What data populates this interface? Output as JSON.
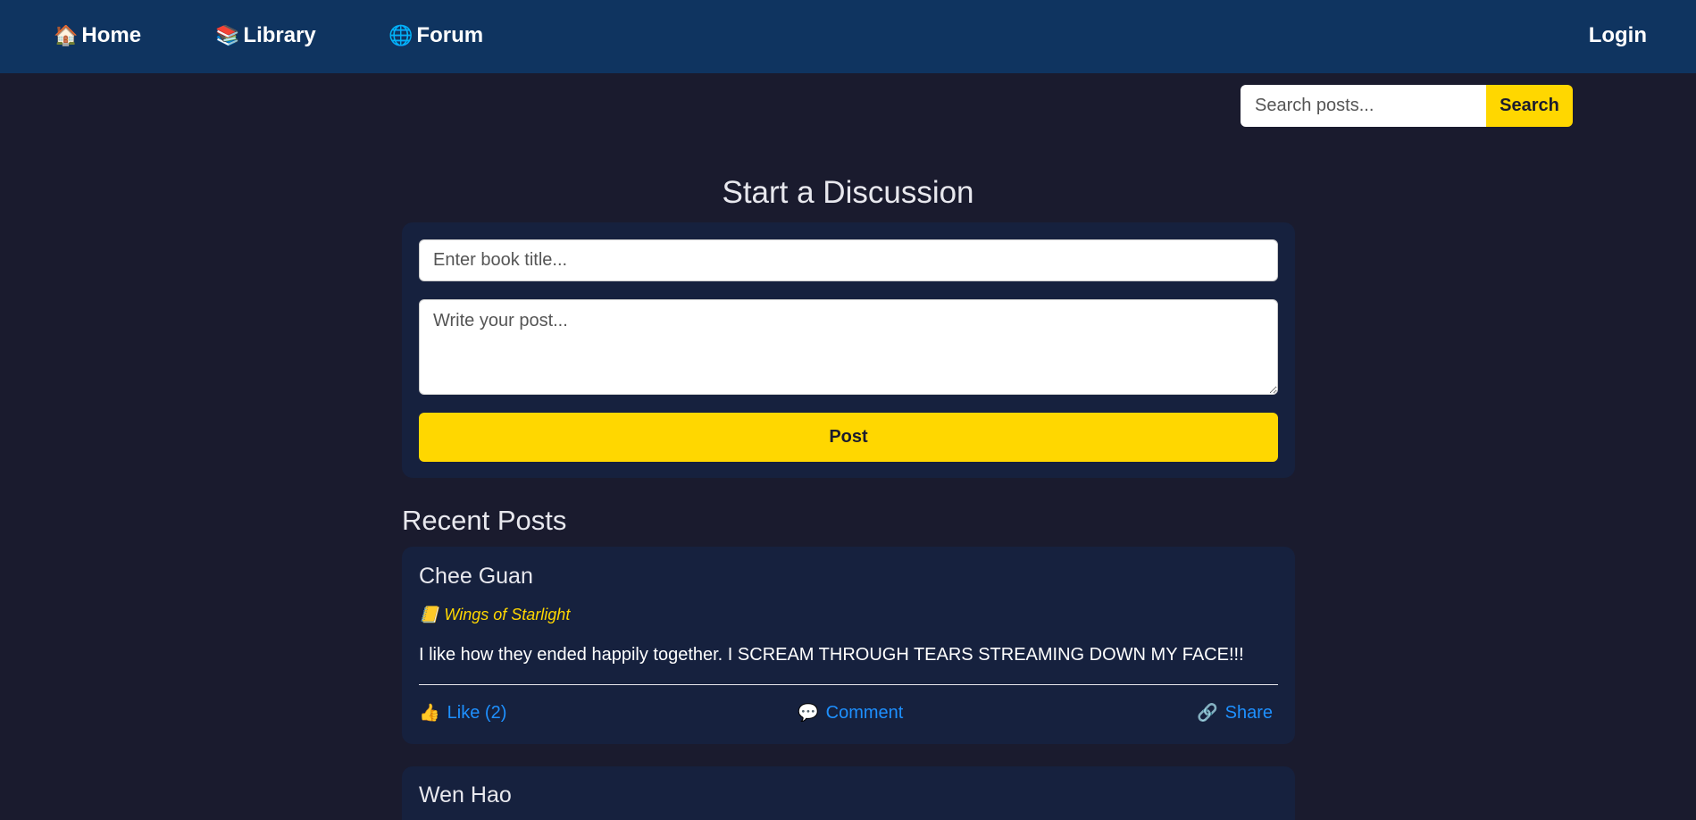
{
  "nav": {
    "home": {
      "icon": "🏠",
      "label": "Home"
    },
    "library": {
      "icon": "📚",
      "label": "Library"
    },
    "forum": {
      "icon": "🌐",
      "label": "Forum"
    },
    "login": "Login"
  },
  "search": {
    "placeholder": "Search posts...",
    "value": "",
    "button": "Search"
  },
  "composer": {
    "heading": "Start a Discussion",
    "title_placeholder": "Enter book title...",
    "body_placeholder": "Write your post...",
    "submit": "Post"
  },
  "feed": {
    "heading": "Recent Posts",
    "posts": [
      {
        "author": "Chee Guan",
        "book_icon": "📒",
        "book": "Wings of Starlight",
        "body": "I like how they ended happily together. I SCREAM THROUGH TEARS STREAMING DOWN MY FACE!!!",
        "like": {
          "icon": "👍",
          "label": "Like (2)"
        },
        "comment": {
          "icon": "💬",
          "label": "Comment"
        },
        "share": {
          "icon": "🔗",
          "label": "Share"
        }
      },
      {
        "author": "Wen Hao"
      }
    ]
  },
  "colors": {
    "page_bg": "#1a1b2e",
    "topbar": "#0f3460",
    "card": "#16213e",
    "accent": "#ffd700",
    "link": "#1e90ff"
  }
}
